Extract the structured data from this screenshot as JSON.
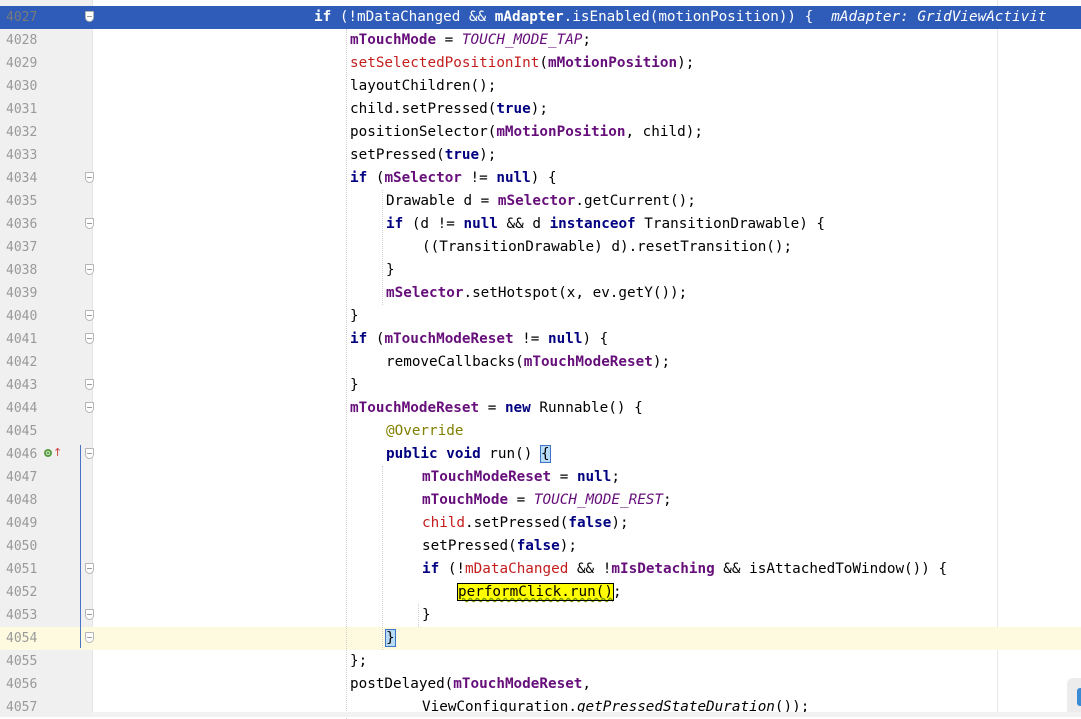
{
  "editor": {
    "hint": "mAdapter: GridViewActivit",
    "lines": [
      {
        "n": "4027",
        "t": [
          [
            "kw",
            "if"
          ],
          [
            "p",
            " (!mDataChanged && "
          ],
          [
            "fld",
            "mAdapter"
          ],
          [
            "p",
            ".isEnabled(motionPosition)) {"
          ]
        ]
      },
      {
        "n": "4028",
        "t": [
          [
            "fld",
            "mTouchMode"
          ],
          [
            "p",
            " = "
          ],
          [
            "cst",
            "TOUCH_MODE_TAP"
          ],
          [
            "p",
            ";"
          ]
        ]
      },
      {
        "n": "4029",
        "t": [
          [
            "inh",
            "setSelectedPositionInt"
          ],
          [
            "p",
            "("
          ],
          [
            "fld",
            "mMotionPosition"
          ],
          [
            "p",
            ");"
          ]
        ]
      },
      {
        "n": "4030",
        "t": [
          [
            "p",
            "layoutChildren();"
          ]
        ]
      },
      {
        "n": "4031",
        "t": [
          [
            "p",
            "child.setPressed("
          ],
          [
            "kw",
            "true"
          ],
          [
            "p",
            ");"
          ]
        ]
      },
      {
        "n": "4032",
        "t": [
          [
            "p",
            "positionSelector("
          ],
          [
            "fld",
            "mMotionPosition"
          ],
          [
            "p",
            ", child);"
          ]
        ]
      },
      {
        "n": "4033",
        "t": [
          [
            "p",
            "setPressed("
          ],
          [
            "kw",
            "true"
          ],
          [
            "p",
            ");"
          ]
        ]
      },
      {
        "n": "4034",
        "t": [
          [
            "kw",
            "if"
          ],
          [
            "p",
            " ("
          ],
          [
            "fld",
            "mSelector"
          ],
          [
            "p",
            " != "
          ],
          [
            "kw",
            "null"
          ],
          [
            "p",
            ") {"
          ]
        ]
      },
      {
        "n": "4035",
        "t": [
          [
            "p",
            "Drawable d = "
          ],
          [
            "fld",
            "mSelector"
          ],
          [
            "p",
            ".getCurrent();"
          ]
        ]
      },
      {
        "n": "4036",
        "t": [
          [
            "kw",
            "if"
          ],
          [
            "p",
            " (d != "
          ],
          [
            "kw",
            "null"
          ],
          [
            "p",
            " && d "
          ],
          [
            "kw",
            "instanceof"
          ],
          [
            "p",
            " TransitionDrawable) {"
          ]
        ]
      },
      {
        "n": "4037",
        "t": [
          [
            "p",
            "((TransitionDrawable) d).resetTransition();"
          ]
        ]
      },
      {
        "n": "4038",
        "t": [
          [
            "p",
            "}"
          ]
        ]
      },
      {
        "n": "4039",
        "t": [
          [
            "fld",
            "mSelector"
          ],
          [
            "p",
            ".setHotspot(x, ev.getY());"
          ]
        ]
      },
      {
        "n": "4040",
        "t": [
          [
            "p",
            "}"
          ]
        ]
      },
      {
        "n": "4041",
        "t": [
          [
            "kw",
            "if"
          ],
          [
            "p",
            " ("
          ],
          [
            "fld",
            "mTouchModeReset"
          ],
          [
            "p",
            " != "
          ],
          [
            "kw",
            "null"
          ],
          [
            "p",
            ") {"
          ]
        ]
      },
      {
        "n": "4042",
        "t": [
          [
            "p",
            "removeCallbacks("
          ],
          [
            "fld",
            "mTouchModeReset"
          ],
          [
            "p",
            ");"
          ]
        ]
      },
      {
        "n": "4043",
        "t": [
          [
            "p",
            "}"
          ]
        ]
      },
      {
        "n": "4044",
        "t": [
          [
            "fld",
            "mTouchModeReset"
          ],
          [
            "p",
            " = "
          ],
          [
            "kw",
            "new"
          ],
          [
            "p",
            " Runnable() {"
          ]
        ]
      },
      {
        "n": "4045",
        "t": [
          [
            "ann",
            "@Override"
          ]
        ]
      },
      {
        "n": "4046",
        "t": [
          [
            "kw",
            "public void"
          ],
          [
            "p",
            " run() "
          ],
          [
            "brace",
            "{"
          ]
        ]
      },
      {
        "n": "4047",
        "t": [
          [
            "fld",
            "mTouchModeReset"
          ],
          [
            "p",
            " = "
          ],
          [
            "kw",
            "null"
          ],
          [
            "p",
            ";"
          ]
        ]
      },
      {
        "n": "4048",
        "t": [
          [
            "fld",
            "mTouchMode"
          ],
          [
            "p",
            " = "
          ],
          [
            "cst",
            "TOUCH_MODE_REST"
          ],
          [
            "p",
            ";"
          ]
        ]
      },
      {
        "n": "4049",
        "t": [
          [
            "inh",
            "child"
          ],
          [
            "p",
            ".setPressed("
          ],
          [
            "kw",
            "false"
          ],
          [
            "p",
            ");"
          ]
        ]
      },
      {
        "n": "4050",
        "t": [
          [
            "p",
            "setPressed("
          ],
          [
            "kw",
            "false"
          ],
          [
            "p",
            ");"
          ]
        ]
      },
      {
        "n": "4051",
        "t": [
          [
            "kw",
            "if"
          ],
          [
            "p",
            " (!"
          ],
          [
            "inh",
            "mDataChanged"
          ],
          [
            "p",
            " && !"
          ],
          [
            "fld",
            "mIsDetaching"
          ],
          [
            "p",
            " && isAttachedToWindow()) {"
          ]
        ]
      },
      {
        "n": "4052",
        "t": [
          [
            "sel",
            "performClick.run()"
          ],
          [
            "p",
            ";"
          ]
        ]
      },
      {
        "n": "4053",
        "t": [
          [
            "p",
            "}"
          ]
        ]
      },
      {
        "n": "4054",
        "t": [
          [
            "brace",
            "}"
          ]
        ]
      },
      {
        "n": "4055",
        "t": [
          [
            "p",
            "};"
          ]
        ]
      },
      {
        "n": "4056",
        "t": [
          [
            "p",
            "postDelayed("
          ],
          [
            "fld",
            "mTouchModeReset"
          ],
          [
            "p",
            ","
          ]
        ]
      },
      {
        "n": "4057",
        "t": [
          [
            "p",
            "ViewConfiguration."
          ],
          [
            "sti",
            "getPressedStateDuration"
          ],
          [
            "p",
            "());"
          ]
        ]
      }
    ]
  },
  "topfrag": "y     _        )          )  ;",
  "colors": {
    "keyword": "#000080",
    "field": "#660e7a",
    "inherited": "#c51d1d",
    "annotation": "#808000",
    "selection": "#2e5cb8",
    "current_line": "#fdfae0",
    "search_highlight": "#ffff00"
  },
  "gutter_icons": {
    "override": "override-icon",
    "implements": "arrow-up-icon"
  }
}
